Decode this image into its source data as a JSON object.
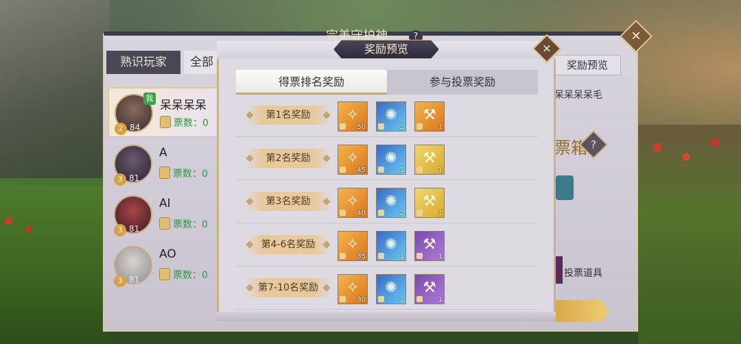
{
  "background_panel": {
    "title": "完美守护神",
    "help_icon": "?",
    "tabs": [
      "熟识玩家",
      "全部"
    ],
    "reward_preview_button": "奖励预览",
    "players": [
      {
        "name": "呆呆呆呆呆",
        "level": "84",
        "rank_badge": "2",
        "is_me": true,
        "me_tag": "我",
        "votes": "票数：0"
      },
      {
        "name": "A",
        "level": "81",
        "rank_badge": "3",
        "is_me": false,
        "votes": "票数：0"
      },
      {
        "name": "AI",
        "level": "81",
        "rank_badge": "3",
        "is_me": false,
        "votes": "票数：0"
      },
      {
        "name": "AO",
        "level": "81",
        "rank_badge": "3",
        "is_me": false,
        "votes": "票数：0"
      }
    ],
    "right_side": {
      "name": "呆呆呆呆毛",
      "box_title": "票箱",
      "vote_item_label": "投票道具"
    }
  },
  "modal": {
    "title": "奖励预览",
    "close_icon": "close-icon",
    "tabs": {
      "active": "得票排名奖励",
      "other": "参与投票奖励"
    },
    "rewards": [
      {
        "rank": "第1名奖励",
        "items": [
          {
            "color": "orange",
            "count": "50"
          },
          {
            "color": "blue",
            "count": "2"
          },
          {
            "color": "orange",
            "count": "1"
          }
        ]
      },
      {
        "rank": "第2名奖励",
        "items": [
          {
            "color": "orange",
            "count": "45"
          },
          {
            "color": "blue",
            "count": "1"
          },
          {
            "color": "gold",
            "count": "1"
          }
        ]
      },
      {
        "rank": "第3名奖励",
        "items": [
          {
            "color": "orange",
            "count": "40"
          },
          {
            "color": "blue",
            "count": "2"
          },
          {
            "color": "gold",
            "count": "1"
          }
        ]
      },
      {
        "rank": "第4-6名奖励",
        "items": [
          {
            "color": "orange",
            "count": "35"
          },
          {
            "color": "blue",
            "count": "1"
          },
          {
            "color": "purple",
            "count": "1"
          }
        ]
      },
      {
        "rank": "第7-10名奖励",
        "items": [
          {
            "color": "orange",
            "count": "30"
          },
          {
            "color": "blue",
            "count": "2"
          },
          {
            "color": "purple",
            "count": "1"
          }
        ]
      }
    ]
  }
}
